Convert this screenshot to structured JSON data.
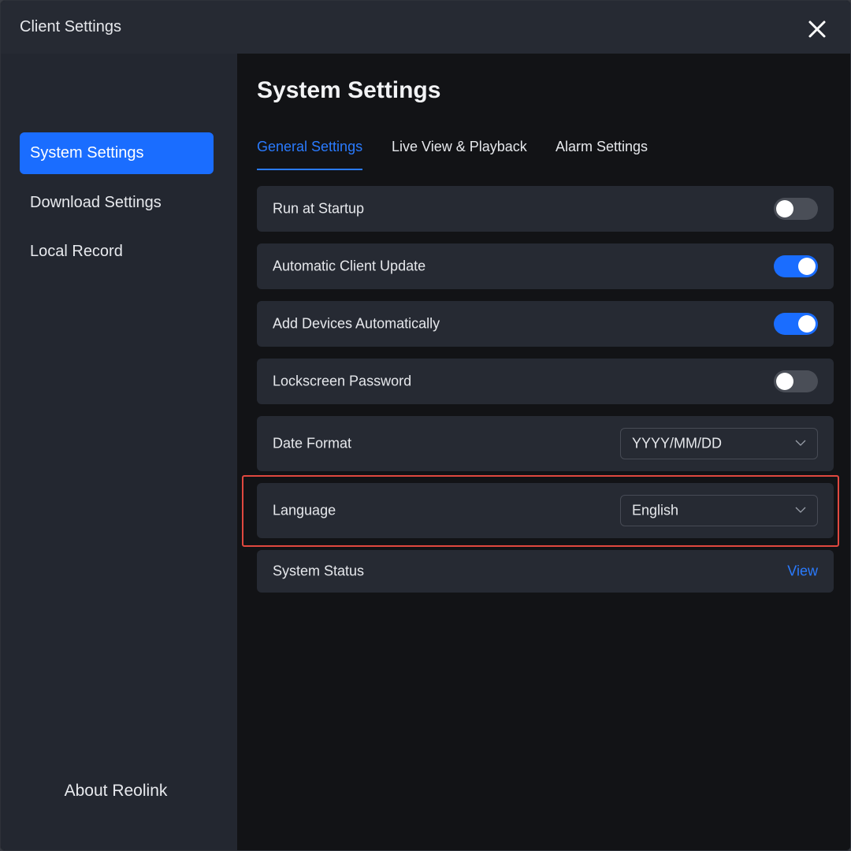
{
  "window": {
    "title": "Client Settings",
    "close_icon": "close-icon"
  },
  "sidebar": {
    "items": [
      {
        "label": "System Settings",
        "active": true
      },
      {
        "label": "Download Settings",
        "active": false
      },
      {
        "label": "Local Record",
        "active": false
      }
    ],
    "about_label": "About Reolink"
  },
  "main": {
    "title": "System Settings",
    "tabs": [
      {
        "label": "General Settings",
        "active": true
      },
      {
        "label": "Live View & Playback",
        "active": false
      },
      {
        "label": "Alarm Settings",
        "active": false
      }
    ],
    "settings": {
      "run_at_startup": {
        "label": "Run at Startup",
        "enabled": false
      },
      "auto_update": {
        "label": "Automatic Client Update",
        "enabled": true
      },
      "add_devices": {
        "label": "Add Devices Automatically",
        "enabled": true
      },
      "lockscreen": {
        "label": "Lockscreen Password",
        "enabled": false
      },
      "date_format": {
        "label": "Date Format",
        "value": "YYYY/MM/DD"
      },
      "language": {
        "label": "Language",
        "value": "English"
      },
      "system_status": {
        "label": "System Status",
        "link": "View"
      }
    }
  },
  "colors": {
    "accent": "#1a6dff",
    "highlight_border": "#e0483f",
    "panel": "#262a33",
    "background": "#121316"
  }
}
